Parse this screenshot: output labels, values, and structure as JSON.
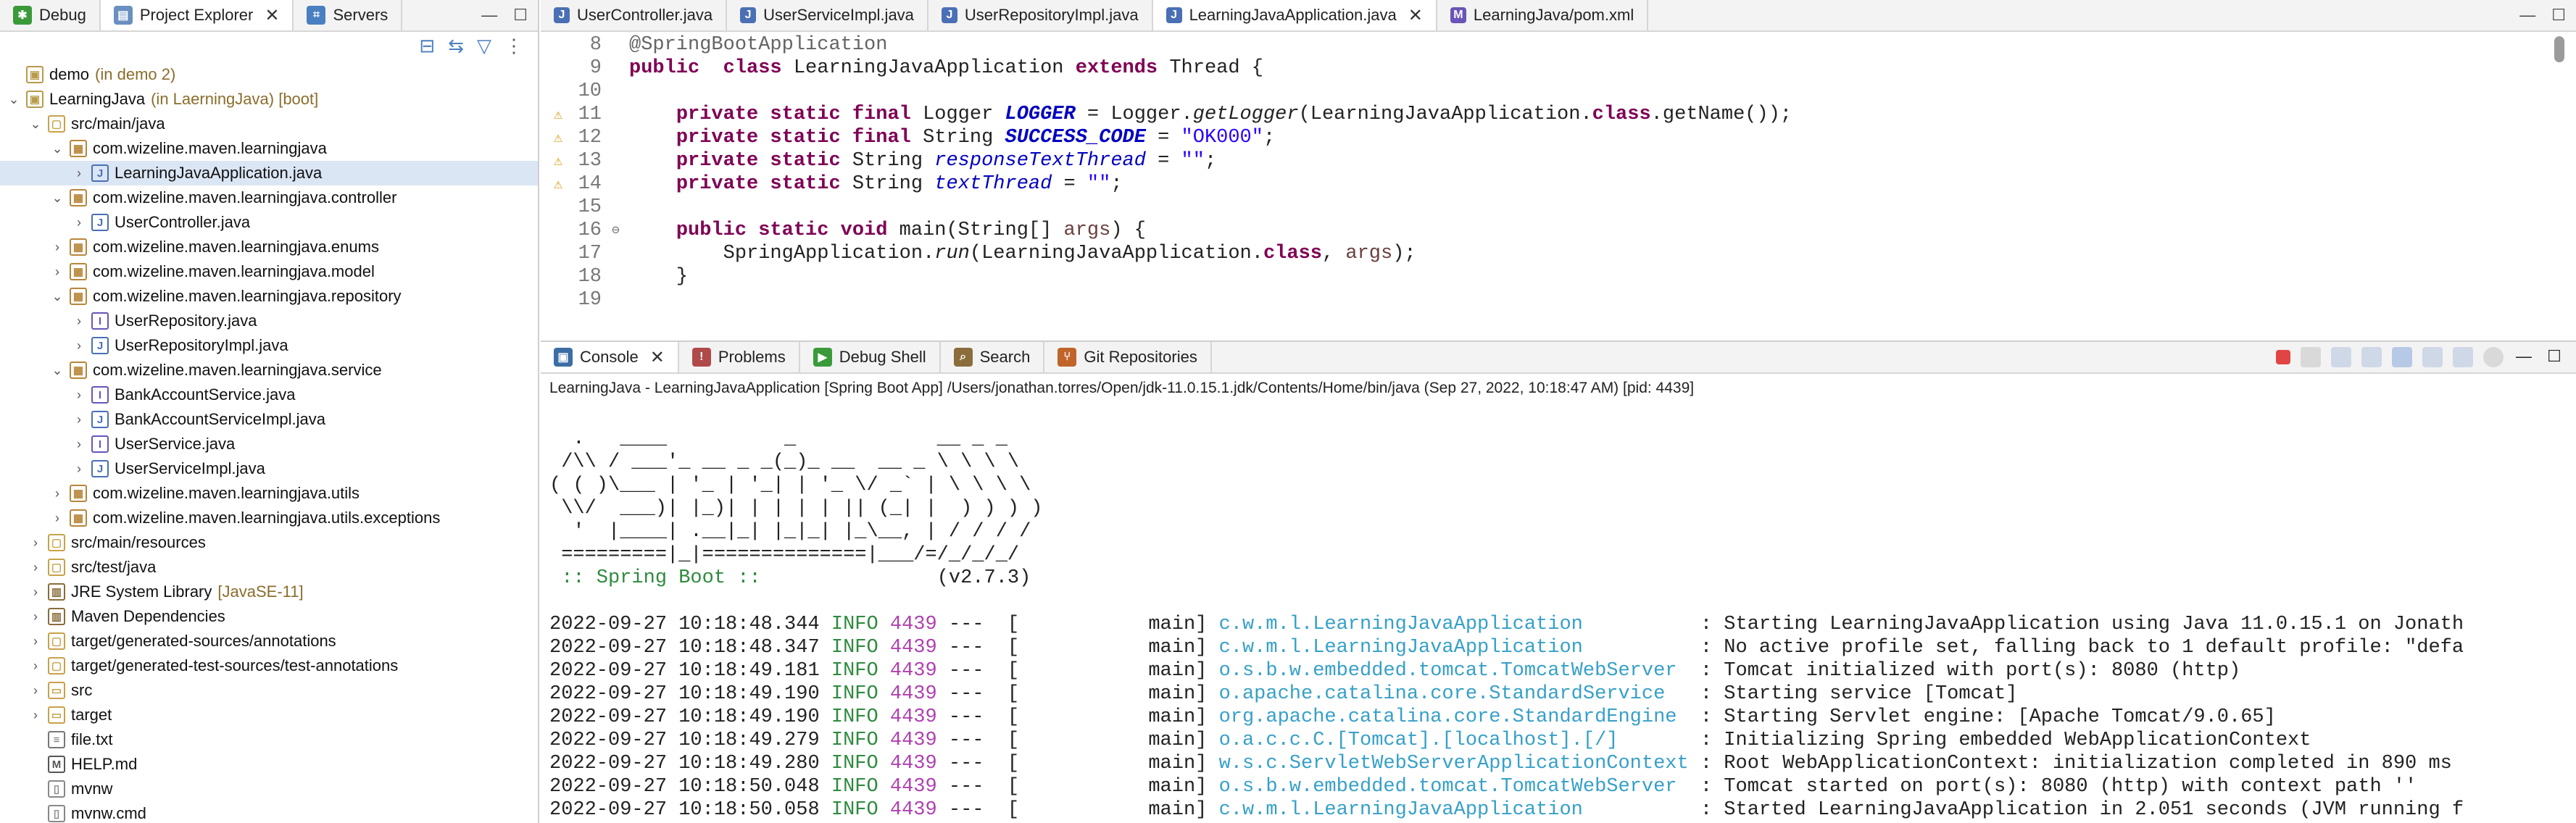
{
  "left_tabs": [
    {
      "label": "Debug",
      "icon": "debug-icon"
    },
    {
      "label": "Project Explorer",
      "icon": "project-explorer-icon",
      "active": true
    },
    {
      "label": "Servers",
      "icon": "servers-icon"
    }
  ],
  "tree": [
    {
      "label": "demo",
      "deco": "(in demo 2)",
      "level": 0,
      "chev": "",
      "icon": "project-icon"
    },
    {
      "label": "LearningJava",
      "deco": "(in LaerningJava) [boot]",
      "level": 0,
      "chev": "v",
      "icon": "project-icon"
    },
    {
      "label": "src/main/java",
      "deco": "",
      "level": 1,
      "chev": "v",
      "icon": "source-folder-icon"
    },
    {
      "label": "com.wizeline.maven.learningjava",
      "deco": "",
      "level": 2,
      "chev": "v",
      "icon": "package-icon"
    },
    {
      "label": "LearningJavaApplication.java",
      "deco": "",
      "level": 3,
      "chev": ">",
      "icon": "java-file-icon",
      "selected": true
    },
    {
      "label": "com.wizeline.maven.learningjava.controller",
      "deco": "",
      "level": 2,
      "chev": "v",
      "icon": "package-icon"
    },
    {
      "label": "UserController.java",
      "deco": "",
      "level": 3,
      "chev": ">",
      "icon": "java-file-icon"
    },
    {
      "label": "com.wizeline.maven.learningjava.enums",
      "deco": "",
      "level": 2,
      "chev": ">",
      "icon": "package-icon"
    },
    {
      "label": "com.wizeline.maven.learningjava.model",
      "deco": "",
      "level": 2,
      "chev": ">",
      "icon": "package-icon"
    },
    {
      "label": "com.wizeline.maven.learningjava.repository",
      "deco": "",
      "level": 2,
      "chev": "v",
      "icon": "package-icon"
    },
    {
      "label": "UserRepository.java",
      "deco": "",
      "level": 3,
      "chev": ">",
      "icon": "java-interface-icon"
    },
    {
      "label": "UserRepositoryImpl.java",
      "deco": "",
      "level": 3,
      "chev": ">",
      "icon": "java-file-icon"
    },
    {
      "label": "com.wizeline.maven.learningjava.service",
      "deco": "",
      "level": 2,
      "chev": "v",
      "icon": "package-icon"
    },
    {
      "label": "BankAccountService.java",
      "deco": "",
      "level": 3,
      "chev": ">",
      "icon": "java-interface-icon"
    },
    {
      "label": "BankAccountServiceImpl.java",
      "deco": "",
      "level": 3,
      "chev": ">",
      "icon": "java-file-icon"
    },
    {
      "label": "UserService.java",
      "deco": "",
      "level": 3,
      "chev": ">",
      "icon": "java-interface-icon"
    },
    {
      "label": "UserServiceImpl.java",
      "deco": "",
      "level": 3,
      "chev": ">",
      "icon": "java-file-icon"
    },
    {
      "label": "com.wizeline.maven.learningjava.utils",
      "deco": "",
      "level": 2,
      "chev": ">",
      "icon": "package-icon"
    },
    {
      "label": "com.wizeline.maven.learningjava.utils.exceptions",
      "deco": "",
      "level": 2,
      "chev": ">",
      "icon": "package-icon"
    },
    {
      "label": "src/main/resources",
      "deco": "",
      "level": 1,
      "chev": ">",
      "icon": "source-folder-icon"
    },
    {
      "label": "src/test/java",
      "deco": "",
      "level": 1,
      "chev": ">",
      "icon": "source-folder-icon"
    },
    {
      "label": "JRE System Library",
      "deco": "[JavaSE-11]",
      "level": 1,
      "chev": ">",
      "icon": "library-icon"
    },
    {
      "label": "Maven Dependencies",
      "deco": "",
      "level": 1,
      "chev": ">",
      "icon": "library-icon"
    },
    {
      "label": "target/generated-sources/annotations",
      "deco": "",
      "level": 1,
      "chev": ">",
      "icon": "source-folder-icon"
    },
    {
      "label": "target/generated-test-sources/test-annotations",
      "deco": "",
      "level": 1,
      "chev": ">",
      "icon": "source-folder-icon"
    },
    {
      "label": "src",
      "deco": "",
      "level": 1,
      "chev": ">",
      "icon": "folder-icon"
    },
    {
      "label": "target",
      "deco": "",
      "level": 1,
      "chev": ">",
      "icon": "folder-icon"
    },
    {
      "label": "file.txt",
      "deco": "",
      "level": 1,
      "chev": "",
      "icon": "text-file-icon"
    },
    {
      "label": "HELP.md",
      "deco": "",
      "level": 1,
      "chev": "",
      "icon": "markdown-file-icon"
    },
    {
      "label": "mvnw",
      "deco": "",
      "level": 1,
      "chev": "",
      "icon": "file-icon"
    },
    {
      "label": "mvnw.cmd",
      "deco": "",
      "level": 1,
      "chev": "",
      "icon": "file-icon"
    }
  ],
  "editor_tabs": [
    {
      "label": "UserController.java"
    },
    {
      "label": "UserServiceImpl.java"
    },
    {
      "label": "UserRepositoryImpl.java"
    },
    {
      "label": "LearningJavaApplication.java",
      "active": true
    },
    {
      "label": "LearningJava/pom.xml"
    }
  ],
  "code": [
    {
      "n": "8",
      "gutter": "",
      "fold": "",
      "t": [
        [
          "ann",
          "@SpringBootApplication"
        ]
      ]
    },
    {
      "n": "9",
      "gutter": "",
      "fold": "",
      "t": [
        [
          "kw",
          "public"
        ],
        [
          "",
          "  "
        ],
        [
          "kw",
          "class"
        ],
        [
          "",
          " LearningJavaApplication "
        ],
        [
          "kw",
          "extends"
        ],
        [
          "",
          " Thread {"
        ]
      ]
    },
    {
      "n": "10",
      "gutter": "",
      "fold": "",
      "t": [
        [
          "",
          ""
        ]
      ]
    },
    {
      "n": "11",
      "gutter": "warn",
      "fold": "",
      "t": [
        [
          "",
          "    "
        ],
        [
          "kw",
          "private static final"
        ],
        [
          "",
          " Logger "
        ],
        [
          "fib",
          "LOGGER"
        ],
        [
          "",
          " = Logger."
        ],
        [
          "me",
          "getLogger"
        ],
        [
          "",
          "(LearningJavaApplication."
        ],
        [
          "kw",
          "class"
        ],
        [
          "",
          ".getName());"
        ]
      ]
    },
    {
      "n": "12",
      "gutter": "warn",
      "fold": "",
      "t": [
        [
          "",
          "    "
        ],
        [
          "kw",
          "private static final"
        ],
        [
          "",
          " String "
        ],
        [
          "fib",
          "SUCCESS_CODE"
        ],
        [
          "",
          " = "
        ],
        [
          "st",
          "\"OK000\""
        ],
        [
          "",
          ";"
        ]
      ]
    },
    {
      "n": "13",
      "gutter": "warn",
      "fold": "",
      "t": [
        [
          "",
          "    "
        ],
        [
          "kw",
          "private static"
        ],
        [
          "",
          " String "
        ],
        [
          "fi",
          "responseTextThread"
        ],
        [
          "",
          " = "
        ],
        [
          "st",
          "\"\""
        ],
        [
          "",
          ";"
        ]
      ]
    },
    {
      "n": "14",
      "gutter": "warn",
      "fold": "",
      "t": [
        [
          "",
          "    "
        ],
        [
          "kw",
          "private static"
        ],
        [
          "",
          " String "
        ],
        [
          "fi",
          "textThread"
        ],
        [
          "",
          " = "
        ],
        [
          "st",
          "\"\""
        ],
        [
          "",
          ";"
        ]
      ]
    },
    {
      "n": "15",
      "gutter": "",
      "fold": "",
      "t": [
        [
          "",
          ""
        ]
      ]
    },
    {
      "n": "16",
      "gutter": "",
      "fold": "⊖",
      "t": [
        [
          "",
          "    "
        ],
        [
          "kw",
          "public static void"
        ],
        [
          "",
          " main(String[] "
        ],
        [
          "pa",
          "args"
        ],
        [
          "",
          ") {"
        ]
      ]
    },
    {
      "n": "17",
      "gutter": "",
      "fold": "",
      "t": [
        [
          "",
          "        SpringApplication."
        ],
        [
          "me",
          "run"
        ],
        [
          "",
          "(LearningJavaApplication."
        ],
        [
          "kw",
          "class"
        ],
        [
          "",
          ", "
        ],
        [
          "pa",
          "args"
        ],
        [
          "",
          ");"
        ]
      ]
    },
    {
      "n": "18",
      "gutter": "",
      "fold": "",
      "t": [
        [
          "",
          "    }"
        ]
      ]
    },
    {
      "n": "19",
      "gutter": "",
      "fold": "",
      "t": [
        [
          "",
          ""
        ]
      ]
    }
  ],
  "console_tabs": [
    {
      "label": "Console",
      "icon": "console-icon",
      "active": true
    },
    {
      "label": "Problems",
      "icon": "problems-icon"
    },
    {
      "label": "Debug Shell",
      "icon": "debug-shell-icon"
    },
    {
      "label": "Search",
      "icon": "search-icon"
    },
    {
      "label": "Git Repositories",
      "icon": "git-repositories-icon"
    }
  ],
  "process": "LearningJava - LearningJavaApplication [Spring Boot App] /Users/jonathan.torres/Open/jdk-11.0.15.1.jdk/Contents/Home/bin/java  (Sep 27, 2022, 10:18:47 AM) [pid: 4439]",
  "banner": [
    "  .   ____          _            __ _ _",
    " /\\\\ / ___'_ __ _ _(_)_ __  __ _ \\ \\ \\ \\",
    "( ( )\\___ | '_ | '_| | '_ \\/ _` | \\ \\ \\ \\",
    " \\\\/  ___)| |_)| | | | | || (_| |  ) ) ) )",
    "  '  |____| .__|_| |_|_| |_\\__, | / / / /",
    " =========|_|==============|___/=/_/_/_/"
  ],
  "banner_tag": " :: Spring Boot :: ",
  "banner_version": "              (v2.7.3)",
  "log": [
    {
      "ts": "2022-09-27 10:18:48.344",
      "lvl": "INFO",
      "pid": "4439",
      "th": "---  [           main]",
      "logger": "c.w.m.l.LearningJavaApplication         ",
      "msg": " : Starting LearningJavaApplication using Java 11.0.15.1 on Jonath"
    },
    {
      "ts": "2022-09-27 10:18:48.347",
      "lvl": "INFO",
      "pid": "4439",
      "th": "---  [           main]",
      "logger": "c.w.m.l.LearningJavaApplication         ",
      "msg": " : No active profile set, falling back to 1 default profile: \"defa"
    },
    {
      "ts": "2022-09-27 10:18:49.181",
      "lvl": "INFO",
      "pid": "4439",
      "th": "---  [           main]",
      "logger": "o.s.b.w.embedded.tomcat.TomcatWebServer ",
      "msg": " : Tomcat initialized with port(s): 8080 (http)"
    },
    {
      "ts": "2022-09-27 10:18:49.190",
      "lvl": "INFO",
      "pid": "4439",
      "th": "---  [           main]",
      "logger": "o.apache.catalina.core.StandardService  ",
      "msg": " : Starting service [Tomcat]"
    },
    {
      "ts": "2022-09-27 10:18:49.190",
      "lvl": "INFO",
      "pid": "4439",
      "th": "---  [           main]",
      "logger": "org.apache.catalina.core.StandardEngine ",
      "msg": " : Starting Servlet engine: [Apache Tomcat/9.0.65]"
    },
    {
      "ts": "2022-09-27 10:18:49.279",
      "lvl": "INFO",
      "pid": "4439",
      "th": "---  [           main]",
      "logger": "o.a.c.c.C.[Tomcat].[localhost].[/]      ",
      "msg": " : Initializing Spring embedded WebApplicationContext"
    },
    {
      "ts": "2022-09-27 10:18:49.280",
      "lvl": "INFO",
      "pid": "4439",
      "th": "---  [           main]",
      "logger": "w.s.c.ServletWebServerApplicationContext",
      "msg": " : Root WebApplicationContext: initialization completed in 890 ms"
    },
    {
      "ts": "2022-09-27 10:18:50.048",
      "lvl": "INFO",
      "pid": "4439",
      "th": "---  [           main]",
      "logger": "o.s.b.w.embedded.tomcat.TomcatWebServer ",
      "msg": " : Tomcat started on port(s): 8080 (http) with context path ''"
    },
    {
      "ts": "2022-09-27 10:18:50.058",
      "lvl": "INFO",
      "pid": "4439",
      "th": "---  [           main]",
      "logger": "c.w.m.l.LearningJavaApplication         ",
      "msg": " : Started LearningJavaApplication in 2.051 seconds (JVM running f"
    }
  ],
  "colors": {
    "selection": "#dbe6f5",
    "keyword": "#7f0055",
    "string": "#2a00ff",
    "field": "#0000c0",
    "info": "#2e8b3e",
    "logger": "#36a0c8",
    "pid": "#b040b0"
  }
}
